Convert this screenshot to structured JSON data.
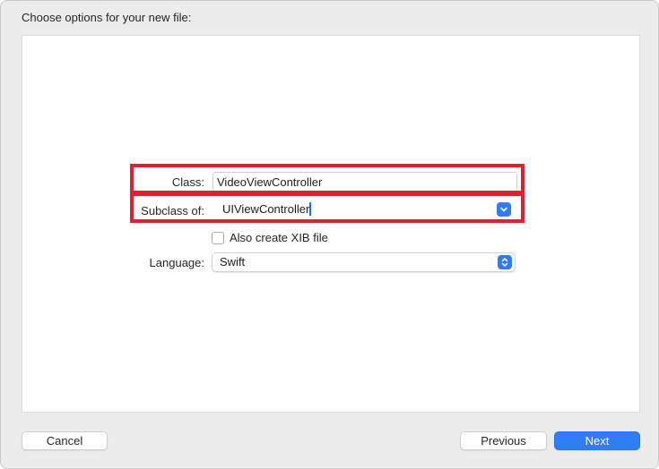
{
  "dialog": {
    "title": "Choose options for your new file:"
  },
  "form": {
    "class_label": "Class:",
    "class_value": "VideoViewController",
    "subclass_label": "Subclass of:",
    "subclass_value": "UIViewController",
    "xib_checkbox_label": "Also create XIB file",
    "xib_checked": false,
    "language_label": "Language:",
    "language_value": "Swift"
  },
  "buttons": {
    "cancel": "Cancel",
    "previous": "Previous",
    "next": "Next"
  },
  "colors": {
    "accent": "#2f7df7",
    "highlight_box": "#e0202e"
  },
  "icons": {
    "subclass_popup": "chevron-down-icon",
    "language_popup": "up-down-chevron-icon"
  }
}
